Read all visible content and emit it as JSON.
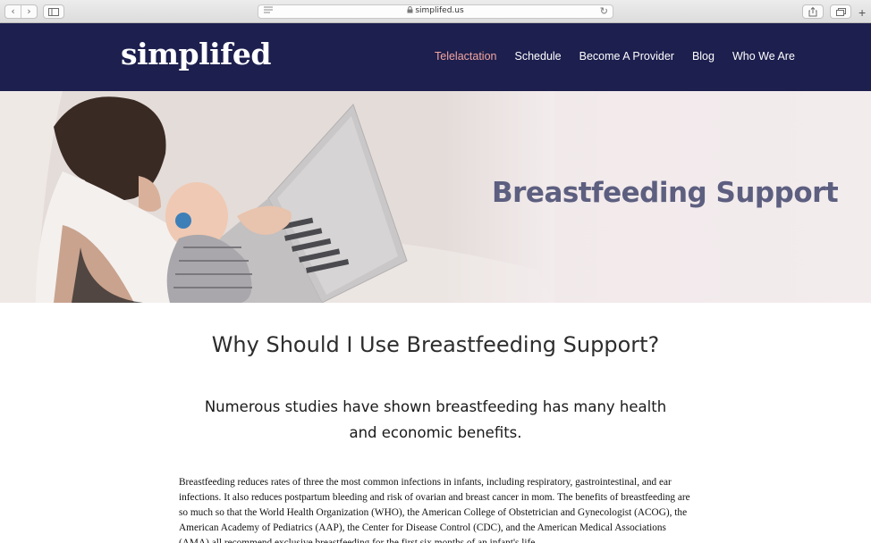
{
  "browser": {
    "url": "simplifed.us",
    "back_glyph": "‹",
    "forward_glyph": "›",
    "reload_glyph": "↻",
    "new_tab_glyph": "+"
  },
  "header": {
    "logo_text": "simplifed",
    "nav": [
      {
        "label": "Telelactation",
        "active": true
      },
      {
        "label": "Schedule",
        "active": false
      },
      {
        "label": "Become A Provider",
        "active": false
      },
      {
        "label": "Blog",
        "active": false
      },
      {
        "label": "Who We Are",
        "active": false
      }
    ],
    "colors": {
      "background": "#1d1f4e",
      "active_link": "#f2a6a0"
    }
  },
  "hero": {
    "title": "Breastfeeding Support",
    "image": "mother-holding-baby-with-laptop"
  },
  "main": {
    "section_title": "Why Should I Use Breastfeeding Support?",
    "subtitle": "Numerous studies have shown breastfeeding has many health and economic benefits.",
    "paragraph": "Breastfeeding reduces rates of three the most common infections in infants, including respiratory, gastrointestinal, and ear infections. It also reduces postpartum bleeding and risk of ovarian and breast cancer in mom. The benefits of breastfeeding are so much so that the World Health Organization (WHO), the American College of Obstetrician and Gynecologist (ACOG), the American Academy of Pediatrics (AAP), the Center for Disease Control (CDC), and the American Medical Associations (AMA) all recommend exclusive breastfeeding for the first six months of an infant's life."
  }
}
